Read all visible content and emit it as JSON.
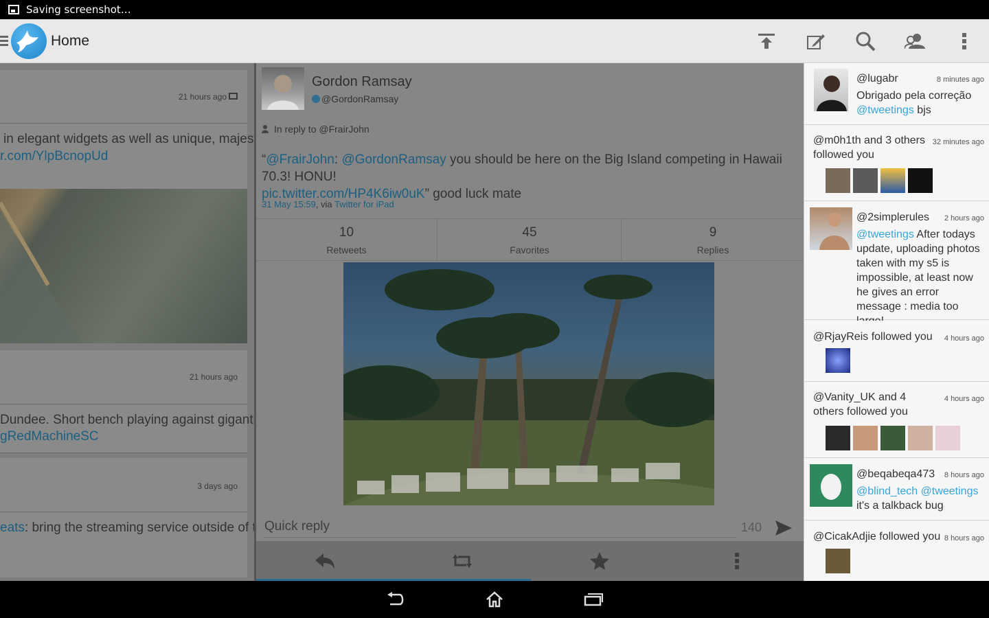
{
  "status_bar": {
    "text": "Saving screenshot…"
  },
  "action_bar": {
    "title": "Home"
  },
  "left_timeline": {
    "card1": {
      "time": "21 hours ago",
      "line1": "in elegant widgets as well as unique, majestic",
      "link": "r.com/YlpBcnopUd"
    },
    "card2": {
      "time": "21 hours ago",
      "line1": "Dundee. Short bench playing against gigantic",
      "link": "gRedMachineSC"
    },
    "card3": {
      "time": "3 days ago",
      "link_prefix": "eats",
      "line1": ": bring the streaming service outside of the"
    }
  },
  "tweet_detail": {
    "name": "Gordon Ramsay",
    "handle": "@GordonRamsay",
    "in_reply_to": "In reply to @FrairJohn",
    "quote_open": "“",
    "mention1": "@FrairJohn",
    "sep": ": ",
    "mention2": "@GordonRamsay",
    "body": " you should be here on the Big Island competing in Hawaii 70.3! HONU!",
    "pic_link": "pic.twitter.com/HP4K6iw0uK",
    "body2": "” good luck mate",
    "date_link": "31 May 15:59",
    "via": ", via ",
    "client_link": "Twitter for iPad",
    "stats": [
      {
        "count": "10",
        "label": "Retweets"
      },
      {
        "count": "45",
        "label": "Favorites"
      },
      {
        "count": "9",
        "label": "Replies"
      }
    ],
    "reply_placeholder": "Quick reply",
    "char_count": "140"
  },
  "notifications": [
    {
      "user": "@lugabr",
      "time": "8 minutes ago",
      "text": "Obrigado pela correção",
      "link": "@tweetings",
      "tail": " bjs"
    },
    {
      "text": "@m0h1th and 3 others followed you",
      "time": "32 minutes ago"
    },
    {
      "user": "@2simplerules",
      "time": "2 hours ago",
      "link": "@tweetings",
      "text": " After todays update, uploading photos taken with my s5 is impossible, at least now he gives an error message : media too large!"
    },
    {
      "text": "@RjayReis followed you",
      "time": "4 hours ago"
    },
    {
      "text": "@Vanity_UK and 4 others followed you",
      "time": "4 hours ago"
    },
    {
      "user": "@beqabeqa473",
      "time": "8 hours ago",
      "link": "@blind_tech @tweetings",
      "text": " it's a talkback bug"
    },
    {
      "text": "@CicakAdjie followed you",
      "time": "8 hours ago"
    }
  ],
  "colors": {
    "accent": "#35a5d8",
    "action_bar": "#e9e9e9",
    "dim_overlay": "#7d7d7d"
  }
}
